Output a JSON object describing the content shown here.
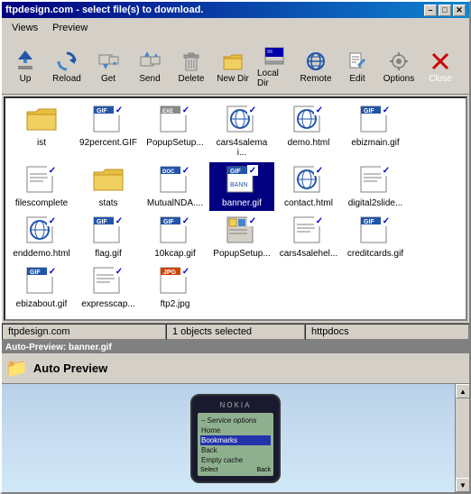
{
  "window": {
    "title": "ftpdesign.com - select file(s) to download.",
    "min_btn": "–",
    "max_btn": "□",
    "close_btn": "✕"
  },
  "menu": {
    "items": [
      "Views",
      "Preview"
    ]
  },
  "toolbar": {
    "buttons": [
      {
        "id": "up",
        "label": "Up",
        "icon": "up"
      },
      {
        "id": "reload",
        "label": "Reload",
        "icon": "reload"
      },
      {
        "id": "get",
        "label": "Get",
        "icon": "get"
      },
      {
        "id": "send",
        "label": "Send",
        "icon": "send"
      },
      {
        "id": "delete",
        "label": "Delete",
        "icon": "delete"
      },
      {
        "id": "newdir",
        "label": "New Dir",
        "icon": "newdir"
      },
      {
        "id": "localdir",
        "label": "Local Dir",
        "icon": "localdir"
      },
      {
        "id": "remote",
        "label": "Remote",
        "icon": "remote"
      },
      {
        "id": "edit",
        "label": "Edit",
        "icon": "edit"
      },
      {
        "id": "options",
        "label": "Options",
        "icon": "options"
      },
      {
        "id": "close",
        "label": "Close",
        "icon": "close-x"
      }
    ]
  },
  "files": [
    {
      "name": "ist",
      "type": "folder",
      "selected": false
    },
    {
      "name": "92percent.GIF",
      "type": "gif",
      "selected": true
    },
    {
      "name": "PopupSetup...",
      "type": "exe",
      "selected": true
    },
    {
      "name": "cars4salemai...",
      "type": "html",
      "selected": true
    },
    {
      "name": "demo.html",
      "type": "html",
      "selected": true
    },
    {
      "name": "ebizmain.gif",
      "type": "gif",
      "selected": true
    },
    {
      "name": "filescomplete",
      "type": "file",
      "selected": true
    },
    {
      "name": "stats",
      "type": "folder",
      "selected": false
    },
    {
      "name": "MutualNDA....",
      "type": "doc",
      "selected": true
    },
    {
      "name": "banner.gif",
      "type": "gif",
      "selected": true,
      "highlighted": true
    },
    {
      "name": "contact.html",
      "type": "html",
      "selected": true
    },
    {
      "name": "digital2slide...",
      "type": "file",
      "selected": true
    },
    {
      "name": "enddemo.html",
      "type": "html",
      "selected": true
    },
    {
      "name": "flag.gif",
      "type": "gif",
      "selected": true
    },
    {
      "name": "10kcap.gif",
      "type": "gif",
      "selected": true
    },
    {
      "name": "PopupSetup...",
      "type": "exe",
      "selected": true
    },
    {
      "name": "cars4salehel...",
      "type": "file",
      "selected": true
    },
    {
      "name": "creditcards.gif",
      "type": "gif",
      "selected": true
    },
    {
      "name": "ebizabout.gif",
      "type": "gif",
      "selected": true
    },
    {
      "name": "expresscap...",
      "type": "file",
      "selected": true
    },
    {
      "name": "ftp2.jpg",
      "type": "jpg",
      "selected": true
    }
  ],
  "statusbar": {
    "site": "ftpdesign.com",
    "selection": "1 objects selected",
    "directory": "httpdocs"
  },
  "preview": {
    "title_bar": "Auto-Preview: banner.gif",
    "header_title": "Auto Preview",
    "phone": {
      "brand": "NOKIA",
      "screen_items": [
        {
          "text": "– Service options",
          "highlighted": false
        },
        {
          "text": "Home",
          "highlighted": false
        },
        {
          "text": "Bookmarks",
          "highlighted": true
        },
        {
          "text": "Back",
          "highlighted": false
        },
        {
          "text": "Empty cache",
          "highlighted": false
        }
      ],
      "nav_left": "Select",
      "nav_right": "Back"
    }
  }
}
